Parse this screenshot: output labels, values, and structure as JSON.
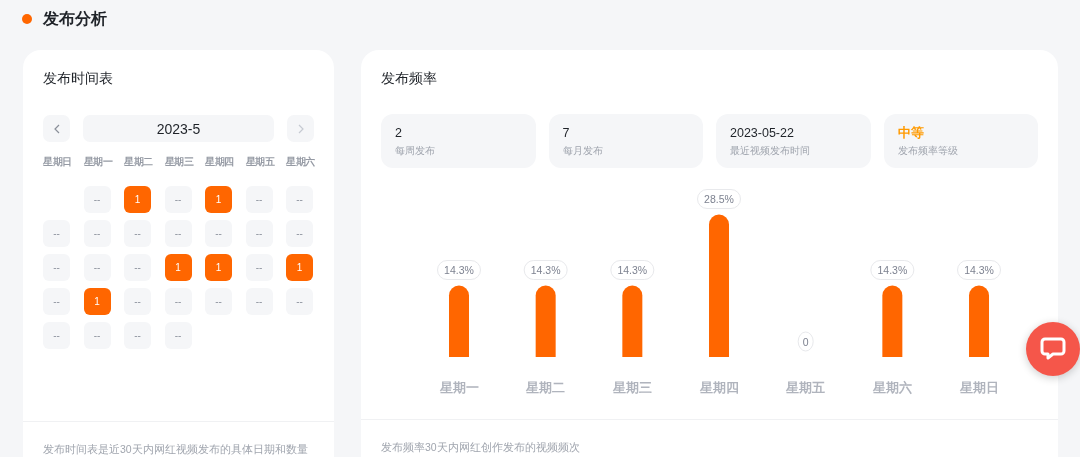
{
  "section": {
    "title": "发布分析"
  },
  "schedule": {
    "title": "发布时间表",
    "month": "2023-5",
    "weekdays": [
      "星期日",
      "星期一",
      "星期二",
      "星期三",
      "星期四",
      "星期五",
      "星期六"
    ],
    "weeks": [
      [
        {
          "kind": "blank"
        },
        {
          "kind": "day",
          "text": "--",
          "active": false
        },
        {
          "kind": "day",
          "text": "1",
          "active": true
        },
        {
          "kind": "day",
          "text": "--",
          "active": false
        },
        {
          "kind": "day",
          "text": "1",
          "active": true
        },
        {
          "kind": "day",
          "text": "--",
          "active": false
        },
        {
          "kind": "day",
          "text": "--",
          "active": false
        }
      ],
      [
        {
          "kind": "day",
          "text": "--",
          "active": false
        },
        {
          "kind": "day",
          "text": "--",
          "active": false
        },
        {
          "kind": "day",
          "text": "--",
          "active": false
        },
        {
          "kind": "day",
          "text": "--",
          "active": false
        },
        {
          "kind": "day",
          "text": "--",
          "active": false
        },
        {
          "kind": "day",
          "text": "--",
          "active": false
        },
        {
          "kind": "day",
          "text": "--",
          "active": false
        }
      ],
      [
        {
          "kind": "day",
          "text": "--",
          "active": false
        },
        {
          "kind": "day",
          "text": "--",
          "active": false
        },
        {
          "kind": "day",
          "text": "--",
          "active": false
        },
        {
          "kind": "day",
          "text": "1",
          "active": true
        },
        {
          "kind": "day",
          "text": "1",
          "active": true
        },
        {
          "kind": "day",
          "text": "--",
          "active": false
        },
        {
          "kind": "day",
          "text": "1",
          "active": true
        }
      ],
      [
        {
          "kind": "day",
          "text": "--",
          "active": false
        },
        {
          "kind": "day",
          "text": "1",
          "active": true
        },
        {
          "kind": "day",
          "text": "--",
          "active": false
        },
        {
          "kind": "day",
          "text": "--",
          "active": false
        },
        {
          "kind": "day",
          "text": "--",
          "active": false
        },
        {
          "kind": "day",
          "text": "--",
          "active": false
        },
        {
          "kind": "day",
          "text": "--",
          "active": false
        }
      ],
      [
        {
          "kind": "day",
          "text": "--",
          "active": false
        },
        {
          "kind": "day",
          "text": "--",
          "active": false
        },
        {
          "kind": "day",
          "text": "--",
          "active": false
        },
        {
          "kind": "day",
          "text": "--",
          "active": false
        },
        {
          "kind": "blank"
        },
        {
          "kind": "blank"
        },
        {
          "kind": "blank"
        }
      ]
    ],
    "footer": "发布时间表是近30天内网红视频发布的具体日期和数量"
  },
  "frequency": {
    "title": "发布频率",
    "stats": [
      {
        "value": "2",
        "label": "每周发布",
        "highlight": false
      },
      {
        "value": "7",
        "label": "每月发布",
        "highlight": false
      },
      {
        "value": "2023-05-22",
        "label": "最近视频发布时间",
        "highlight": false
      },
      {
        "value": "中等",
        "label": "发布频率等级",
        "highlight": true
      }
    ],
    "chart_data": {
      "type": "bar",
      "categories": [
        "星期一",
        "星期二",
        "星期三",
        "星期四",
        "星期五",
        "星期六",
        "星期日"
      ],
      "values": [
        14.3,
        14.3,
        14.3,
        28.5,
        0,
        14.3,
        14.3
      ],
      "value_labels": [
        "14.3%",
        "14.3%",
        "14.3%",
        "28.5%",
        "0",
        "14.3%",
        "14.3%"
      ]
    },
    "footer": "发布频率30天内网红创作发布的视频频次"
  }
}
